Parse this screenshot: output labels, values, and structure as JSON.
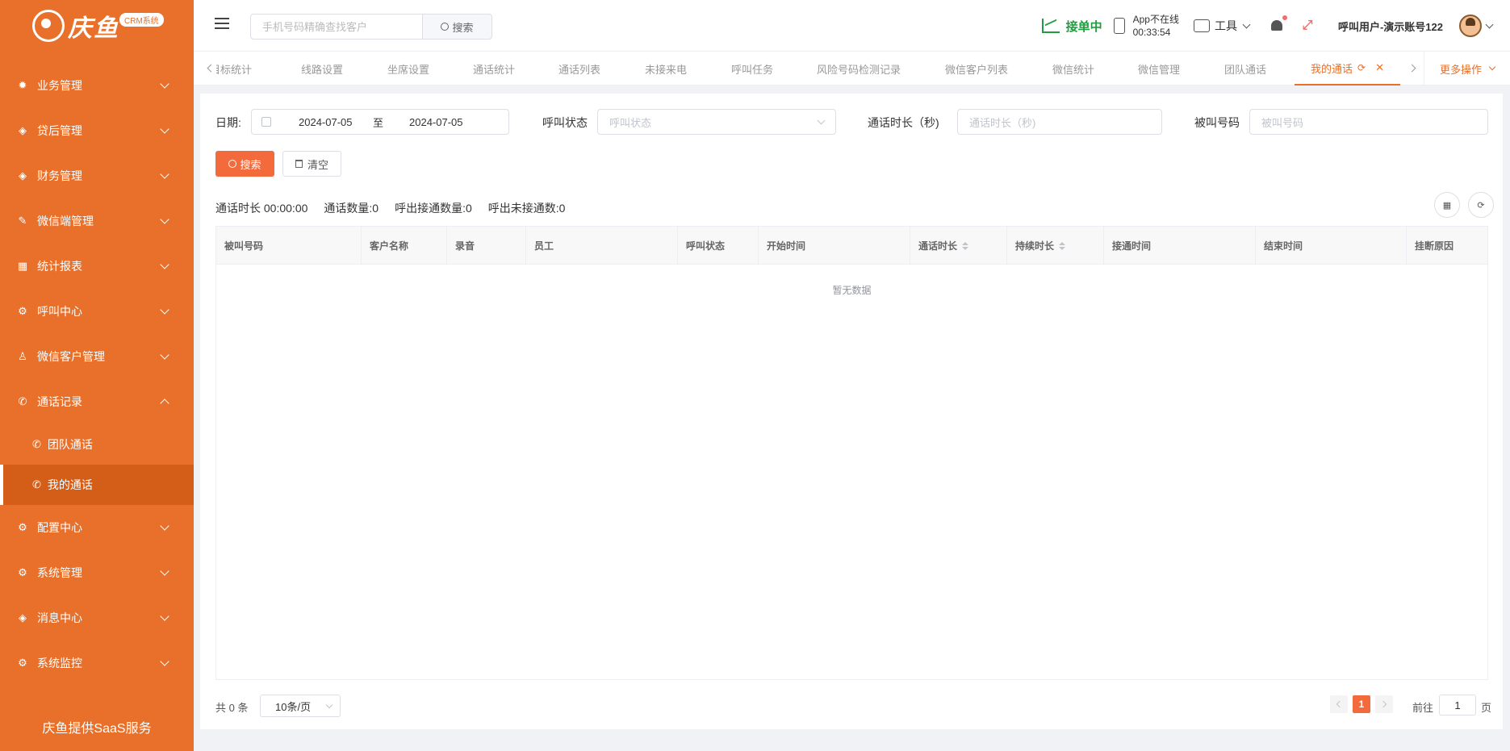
{
  "brand": {
    "logo_text": "庆鱼",
    "badge": "CRM系统",
    "footer": "庆鱼提供SaaS服务"
  },
  "sidebar": {
    "items": [
      {
        "label": "业务管理",
        "icon": "gear-bug-icon",
        "expanded": false
      },
      {
        "label": "贷后管理",
        "icon": "tag-icon",
        "expanded": false
      },
      {
        "label": "财务管理",
        "icon": "tag-icon",
        "expanded": false
      },
      {
        "label": "微信端管理",
        "icon": "edit-icon",
        "expanded": false
      },
      {
        "label": "统计报表",
        "icon": "table-icon",
        "expanded": false
      },
      {
        "label": "呼叫中心",
        "icon": "gear-icon",
        "expanded": false
      },
      {
        "label": "微信客户管理",
        "icon": "user-icon",
        "expanded": false
      },
      {
        "label": "通话记录",
        "icon": "phone-icon",
        "expanded": true
      },
      {
        "label": "配置中心",
        "icon": "gear-icon",
        "expanded": false
      },
      {
        "label": "系统管理",
        "icon": "gear-icon",
        "expanded": false
      },
      {
        "label": "消息中心",
        "icon": "tag-icon",
        "expanded": false
      },
      {
        "label": "系统监控",
        "icon": "gear-icon",
        "expanded": false
      }
    ],
    "sub_items": [
      {
        "label": "团队通话",
        "icon": "phone-icon",
        "active": false
      },
      {
        "label": "我的通话",
        "icon": "phone-icon",
        "active": true
      }
    ]
  },
  "header": {
    "search_placeholder": "手机号码精确查找客户",
    "search_button": "搜索",
    "order_status": "接单中",
    "app_status_line1": "App不在线",
    "app_status_line2": "00:33:54",
    "tools_label": "工具",
    "username": "呼叫用户-演示账号122"
  },
  "tabs": {
    "items": [
      "目标统计",
      "线路设置",
      "坐席设置",
      "通话统计",
      "通话列表",
      "未接来电",
      "呼叫任务",
      "风险号码检测记录",
      "微信客户列表",
      "微信统计",
      "微信管理",
      "团队通话",
      "我的通话"
    ],
    "active_index": 12,
    "more": "更多操作"
  },
  "filters": {
    "date_label": "日期:",
    "date_start": "2024-07-05",
    "date_sep": "至",
    "date_end": "2024-07-05",
    "status_label": "呼叫状态",
    "status_placeholder": "呼叫状态",
    "duration_label": "通话时长（秒)",
    "duration_placeholder": "通话时长（秒)",
    "called_label": "被叫号码",
    "called_placeholder": "被叫号码",
    "search_button": "搜索",
    "clear_button": "清空"
  },
  "stats": {
    "duration": "通话时长 00:00:00",
    "count": "通话数量:0",
    "outbound_connected": "呼出接通数量:0",
    "outbound_unconnected": "呼出未接通数:0"
  },
  "table": {
    "columns": [
      "被叫号码",
      "客户名称",
      "录音",
      "员工",
      "呼叫状态",
      "开始时间",
      "通话时长",
      "持续时长",
      "接通时间",
      "结束时间",
      "挂断原因"
    ],
    "rows": [],
    "empty_text": "暂无数据"
  },
  "pagination": {
    "total": "共 0 条",
    "page_size": "10条/页",
    "current_page": "1",
    "goto_label": "前往",
    "goto_value": "1",
    "goto_unit": "页"
  },
  "colors": {
    "sidebar": "#e8702a",
    "accent": "#f36a3c",
    "green": "#1f9d3f"
  }
}
